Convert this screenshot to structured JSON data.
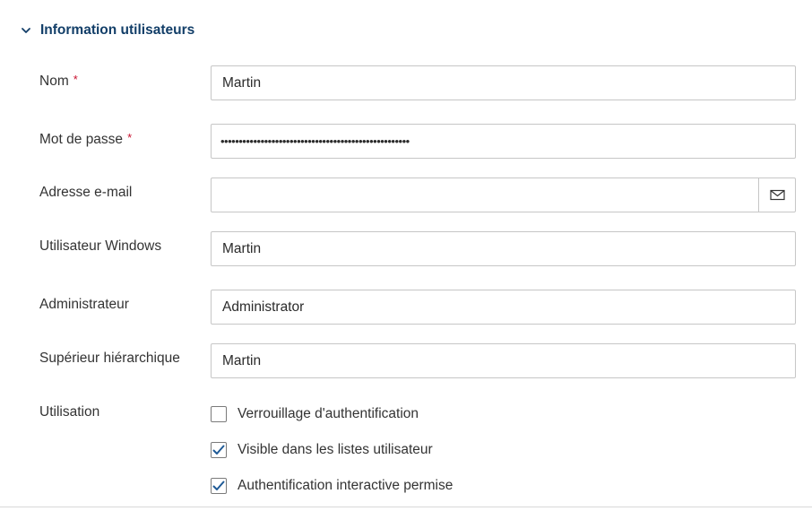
{
  "section": {
    "title": "Information utilisateurs",
    "icon": "chevron-down-icon",
    "accent_color": "#123e68"
  },
  "required_marker": "*",
  "fields": {
    "name": {
      "label": "Nom",
      "value": "Martin",
      "required": true
    },
    "password": {
      "label": "Mot de passe",
      "value": "••••••••••••••••••••••••••••••••••••••••••••••••••••",
      "required": true
    },
    "email": {
      "label": "Adresse e-mail",
      "value": "",
      "button_icon": "mail-icon"
    },
    "windows_user": {
      "label": "Utilisateur Windows",
      "value": "Martin"
    },
    "administrator": {
      "label": "Administrateur",
      "value": "Administrator"
    },
    "supervisor": {
      "label": "Supérieur hiérarchique",
      "value": "Martin"
    }
  },
  "usage": {
    "label": "Utilisation",
    "options": [
      {
        "label": "Verrouillage d'authentification",
        "checked": false
      },
      {
        "label": "Visible dans les listes utilisateur",
        "checked": true
      },
      {
        "label": "Authentification interactive permise",
        "checked": true
      }
    ],
    "check_color": "#1f5a96"
  }
}
